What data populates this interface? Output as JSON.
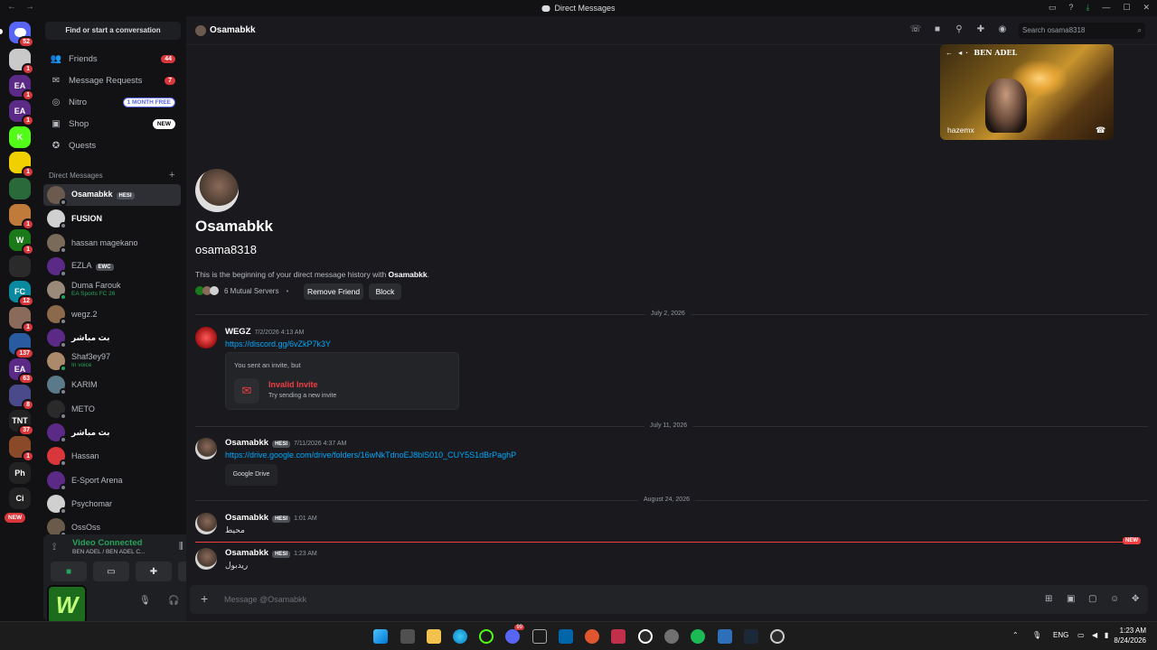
{
  "window": {
    "title": "Direct Messages",
    "minimize": "—",
    "maximize": "☐",
    "close": "✕"
  },
  "rail": {
    "home_badge": "52",
    "servers": [
      {
        "name": "server-1",
        "abbr": "",
        "color": "#c9c9c9",
        "badge": "1"
      },
      {
        "name": "ea-1",
        "abbr": "EA",
        "color": "#5b2a86",
        "badge": "1"
      },
      {
        "name": "ea-2",
        "abbr": "EA",
        "color": "#5b2a86",
        "badge": "1"
      },
      {
        "name": "k-server",
        "abbr": "K",
        "color": "#53fc18",
        "badge": ""
      },
      {
        "name": "server-5",
        "abbr": "",
        "color": "#f0d000",
        "badge": "1"
      },
      {
        "name": "server-6",
        "abbr": "",
        "color": "#2a6a3a",
        "badge": ""
      },
      {
        "name": "server-7",
        "abbr": "",
        "color": "#c07a3a",
        "badge": "1"
      },
      {
        "name": "w-server",
        "abbr": "W",
        "color": "#1a7a1a",
        "badge": "1"
      },
      {
        "name": "server-9",
        "abbr": "",
        "color": "#2a2a2a",
        "badge": ""
      },
      {
        "name": "fc-server",
        "abbr": "FC",
        "color": "#0a8aa0",
        "badge": "12"
      },
      {
        "name": "server-11",
        "abbr": "",
        "color": "#8a6a5a",
        "badge": "1"
      },
      {
        "name": "server-12",
        "abbr": "",
        "color": "#2a5aa0",
        "badge": "137"
      },
      {
        "name": "ea-3",
        "abbr": "EA",
        "color": "#5b2a86",
        "badge": "63"
      },
      {
        "name": "server-14",
        "abbr": "",
        "color": "#4a4a8a",
        "badge": "8"
      },
      {
        "name": "tnt-server",
        "abbr": "TNT",
        "color": "#222",
        "badge": "37"
      },
      {
        "name": "server-16",
        "abbr": "",
        "color": "#8a4a2a",
        "badge": "1"
      },
      {
        "name": "phoenix-server",
        "abbr": "Ph",
        "color": "#222",
        "badge": ""
      },
      {
        "name": "cipher-server",
        "abbr": "Ci",
        "color": "#222",
        "badge": ""
      }
    ],
    "new_label": "NEW"
  },
  "sidebar": {
    "find_label": "Find or start a conversation",
    "nav": [
      {
        "label": "Friends",
        "badge": "44",
        "tag": "",
        "icon": "friends-icon",
        "glyph": "👥"
      },
      {
        "label": "Message Requests",
        "badge": "7",
        "tag": "",
        "icon": "mail-icon",
        "glyph": "✉"
      },
      {
        "label": "Nitro",
        "badge": "",
        "tag": "1 MONTH FREE",
        "icon": "nitro-icon",
        "glyph": "◎"
      },
      {
        "label": "Shop",
        "badge": "",
        "tag": "NEW",
        "icon": "shop-icon",
        "glyph": "▣"
      },
      {
        "label": "Quests",
        "badge": "",
        "tag": "",
        "icon": "quests-icon",
        "glyph": "✪"
      }
    ],
    "dm_header": "Direct Messages",
    "dm_plus": "+",
    "dms": [
      {
        "name": "Osamabkk",
        "tag": "HESI",
        "sub": "",
        "color": "#6b5a4e",
        "status": "#80848e",
        "active": true,
        "bold": false
      },
      {
        "name": "FUSION",
        "tag": "",
        "sub": "",
        "color": "#d0d0d0",
        "status": "#80848e",
        "active": false,
        "bold": true
      },
      {
        "name": "hassan magekano",
        "tag": "",
        "sub": "",
        "color": "#7a6a5a",
        "status": "#80848e",
        "active": false,
        "bold": false
      },
      {
        "name": "EZLA",
        "tag": "EWC",
        "sub": "",
        "color": "#5b2a86",
        "status": "#80848e",
        "active": false,
        "bold": false
      },
      {
        "name": "Duma Farouk",
        "tag": "",
        "sub": "EA Sports FC 26",
        "color": "#9a8a7a",
        "status": "#23a55a",
        "active": false,
        "bold": false
      },
      {
        "name": "wegz.2",
        "tag": "",
        "sub": "",
        "color": "#8a6a4a",
        "status": "#80848e",
        "active": false,
        "bold": false
      },
      {
        "name": "بث مباشر",
        "tag": "",
        "sub": "",
        "color": "#5b2a86",
        "status": "#80848e",
        "active": false,
        "bold": true
      },
      {
        "name": "Shaf3ey97",
        "tag": "",
        "sub": "In voice",
        "color": "#aa8a6a",
        "status": "#23a55a",
        "active": false,
        "bold": false
      },
      {
        "name": "KARIM",
        "tag": "",
        "sub": "",
        "color": "#5a7a8a",
        "status": "#80848e",
        "active": false,
        "bold": false
      },
      {
        "name": "METO",
        "tag": "",
        "sub": "",
        "color": "#2a2a2a",
        "status": "#80848e",
        "active": false,
        "bold": false
      },
      {
        "name": "بث مباشر",
        "tag": "",
        "sub": "",
        "color": "#5b2a86",
        "status": "#80848e",
        "active": false,
        "bold": true
      },
      {
        "name": "Hassan",
        "tag": "",
        "sub": "",
        "color": "#da373c",
        "status": "#80848e",
        "active": false,
        "bold": false
      },
      {
        "name": "E-Sport Arena",
        "tag": "",
        "sub": "",
        "color": "#5b2a86",
        "status": "#80848e",
        "active": false,
        "bold": false
      },
      {
        "name": "Psychomar",
        "tag": "",
        "sub": "",
        "color": "#d0d0d0",
        "status": "#80848e",
        "active": false,
        "bold": false
      },
      {
        "name": "OssOss",
        "tag": "",
        "sub": "",
        "color": "#6a5a4a",
        "status": "#80848e",
        "active": false,
        "bold": false
      }
    ],
    "voice": {
      "title": "Video Connected",
      "sub": "BEN ADEL / BEN ADEL C..."
    }
  },
  "header": {
    "username": "Osamabkk",
    "search_placeholder": "Search osama8318"
  },
  "pip": {
    "channel": "BEN ADEL",
    "user": "hazemx"
  },
  "profile": {
    "display_name": "Osamabkk",
    "username": "osama8318",
    "intro_prefix": "This is the beginning of your direct message history with ",
    "intro_name": "Osamabkk",
    "intro_suffix": ".",
    "mutual": "6 Mutual Servers",
    "separator": "•",
    "remove_friend": "Remove Friend",
    "block": "Block"
  },
  "dividers": [
    "July 2, 2026",
    "July 11, 2026",
    "August 24, 2026"
  ],
  "messages": {
    "m1": {
      "author": "WEGZ",
      "time": "7/2/2026 4:13 AM",
      "link": "https://discord.gg/6vZkP7k3Y",
      "invite_head": "You sent an invite, but",
      "invite_title": "Invalid Invite",
      "invite_sub": "Try sending a new invite"
    },
    "m2": {
      "author": "Osamabkk",
      "tag": "HESI",
      "time": "7/11/2026 4:37 AM",
      "link": "https://drive.google.com/drive/folders/16wNkTdnoEJ8blS010_CUY5S1dBrPaghP",
      "embed": "Google Drive"
    },
    "m3": {
      "author": "Osamabkk",
      "tag": "HESI",
      "time": "1:01 AM",
      "text": "محيط"
    },
    "m4": {
      "author": "Osamabkk",
      "tag": "HESI",
      "time": "1:23 AM",
      "text": "ريدبول"
    },
    "new_label": "NEW"
  },
  "composer": {
    "placeholder": "Message @Osamabkk",
    "plus": "+"
  },
  "taskbar": {
    "lang": "ENG",
    "time": "1:23 AM",
    "date": "8/24/2026",
    "discord_badge": "99"
  }
}
